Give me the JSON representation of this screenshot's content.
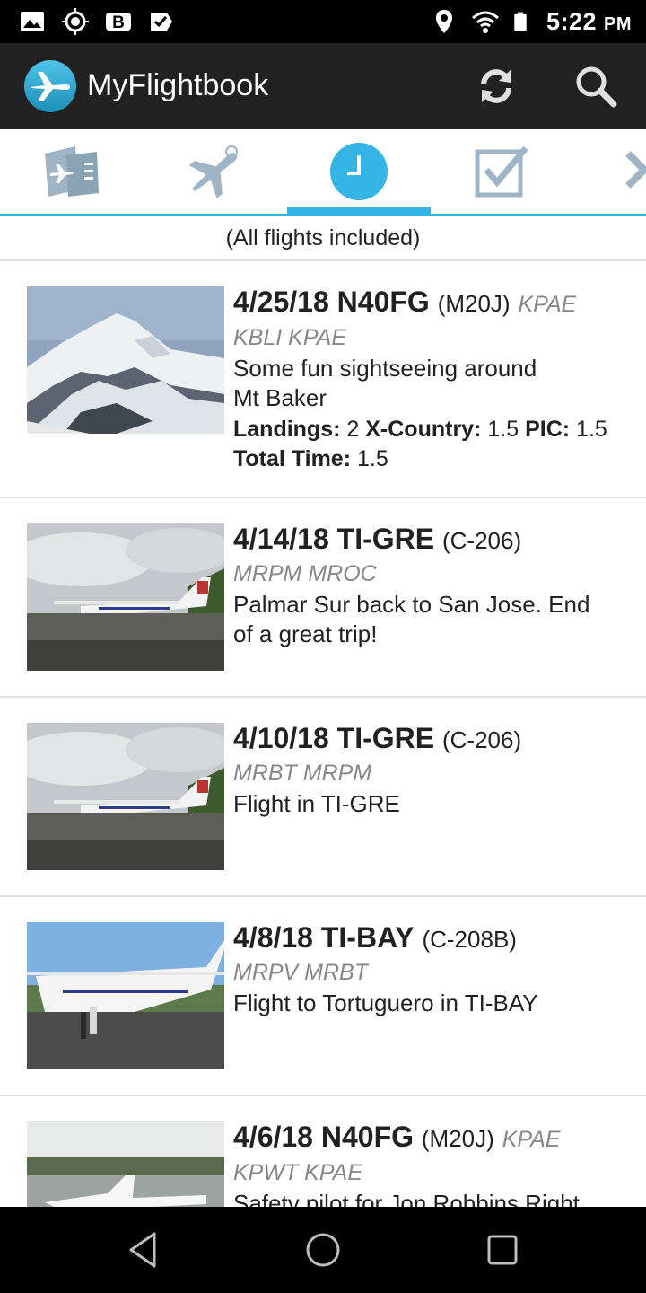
{
  "status_bar": {
    "time": "5:22",
    "ampm": "PM",
    "left_icons": [
      "image-icon",
      "location-target-icon",
      "b-icon",
      "checkbox-icon"
    ],
    "right_icons": [
      "location-pin-icon",
      "wifi-icon",
      "battery-icon"
    ]
  },
  "app_bar": {
    "title": "MyFlightbook",
    "logo_icon": "airplane-logo-icon",
    "actions": [
      "refresh-icon",
      "search-icon"
    ]
  },
  "tabs": [
    {
      "name": "new-flight",
      "icon": "logbook-icon",
      "selected": false
    },
    {
      "name": "aircraft",
      "icon": "airplane-icon",
      "selected": false
    },
    {
      "name": "recent-flights",
      "icon": "clock-icon",
      "selected": true
    },
    {
      "name": "totals",
      "icon": "checkbox-icon",
      "selected": false
    },
    {
      "name": "more",
      "icon": "partial-icon",
      "selected": false
    }
  ],
  "filter_note": "(All flights included)",
  "flights": [
    {
      "date": "4/25/18",
      "tail": "N40FG",
      "model": "(M20J)",
      "route_inline": "KPAE",
      "route": "KBLI KPAE",
      "comment_line1": "Some fun sightseeing around",
      "comment_line2": "Mt Baker",
      "stats": {
        "landings_label": "Landings:",
        "landings": "2",
        "xc_label": "X-Country:",
        "xc": "1.5",
        "pic_label": "PIC:",
        "pic": "1.5",
        "total_label": "Total Time:",
        "total": "1.5"
      }
    },
    {
      "date": "4/14/18",
      "tail": "TI-GRE",
      "model": "(C-206)",
      "route": "MRPM MROC",
      "comment_line1": "Palmar Sur back to San Jose. End",
      "comment_line2": "of a great trip!"
    },
    {
      "date": "4/10/18",
      "tail": "TI-GRE",
      "model": "(C-206)",
      "route": "MRBT MRPM",
      "comment_line1": "Flight in TI-GRE"
    },
    {
      "date": "4/8/18",
      "tail": "TI-BAY",
      "model": "(C-208B)",
      "route": "MRPV MRBT",
      "comment_line1": "Flight to Tortuguero in TI-BAY"
    },
    {
      "date": "4/6/18",
      "tail": "N40FG",
      "model": "(M20J)",
      "route_inline": "KPAE",
      "route": "KPWT KPAE",
      "comment_line1": "Safety pilot for Jon Robbins Right"
    }
  ],
  "nav_bar": [
    "back-icon",
    "home-icon",
    "recents-icon"
  ],
  "colors": {
    "accent": "#34b5e5",
    "app_bar": "#212121",
    "route": "#888888"
  }
}
